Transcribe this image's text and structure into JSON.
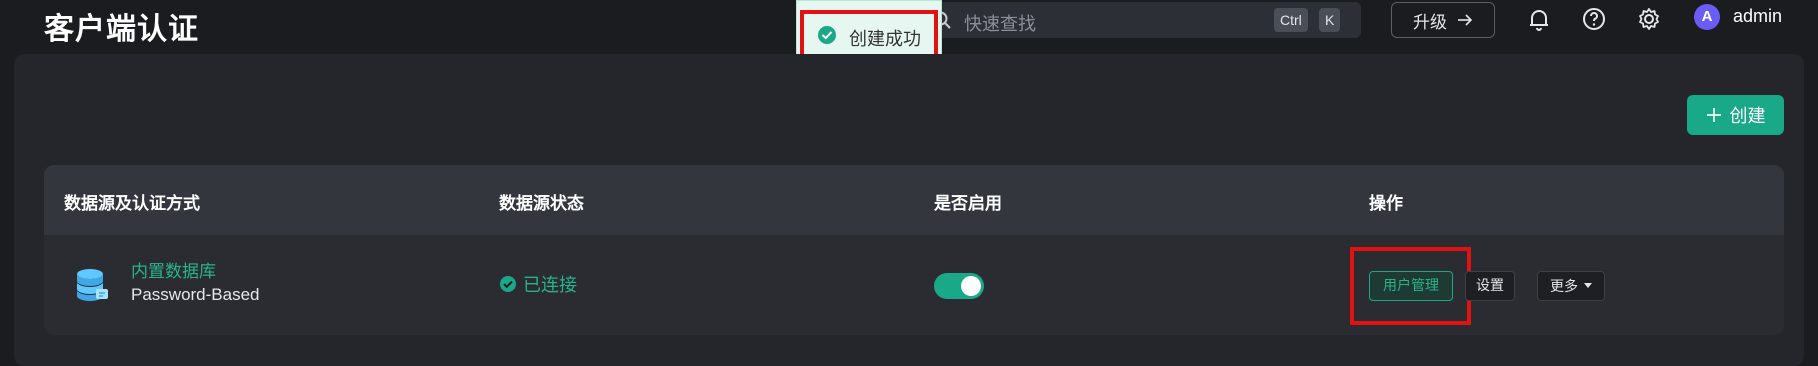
{
  "header": {
    "title": "客户端认证",
    "search": {
      "placeholder": "快速查找",
      "shortcut_ctrl": "Ctrl",
      "shortcut_key": "K"
    },
    "upgrade_label": "升级",
    "icons": [
      "bell-icon",
      "help-icon",
      "gear-icon"
    ],
    "user": {
      "avatar_letter": "A",
      "name": "admin"
    }
  },
  "toast": {
    "message": "创建成功",
    "icon": "check-circle-icon"
  },
  "actions": {
    "create_label": "创建"
  },
  "table": {
    "columns": [
      "数据源及认证方式",
      "数据源状态",
      "是否启用",
      "操作"
    ],
    "rows": [
      {
        "datasource": "内置数据库",
        "method": "Password-Based",
        "status": "已连接",
        "enabled": true,
        "buttons": {
          "users": "用户管理",
          "settings": "设置",
          "more": "更多"
        }
      }
    ]
  },
  "colors": {
    "accent": "#1aa988",
    "highlight": "#e21212",
    "background": "#1b1c20"
  }
}
